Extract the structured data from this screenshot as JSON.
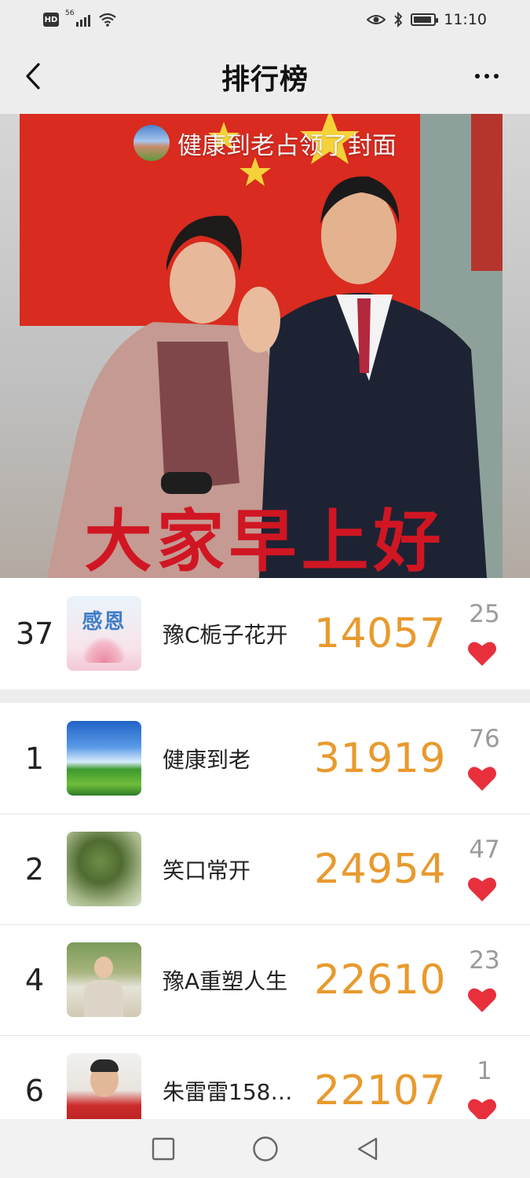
{
  "status_bar": {
    "hd": "HD",
    "network": "56",
    "time": "11:10",
    "battery_level": 0.9
  },
  "nav": {
    "title": "排行榜"
  },
  "cover": {
    "owner_caption": "健康到老占领了封面",
    "greeting": "大家早上好",
    "flag_color": "#d92b1f"
  },
  "my_rank": {
    "rank": "37",
    "avatar_text": "感恩",
    "name": "豫C栀子花开",
    "steps": "14057",
    "likes": "25"
  },
  "rankings": [
    {
      "rank": "1",
      "name": "健康到老",
      "steps": "31919",
      "likes": "76",
      "avatar": "sky"
    },
    {
      "rank": "2",
      "name": "笑口常开",
      "steps": "24954",
      "likes": "47",
      "avatar": "tree"
    },
    {
      "rank": "4",
      "name": "豫A重塑人生",
      "steps": "22610",
      "likes": "23",
      "avatar": "person"
    },
    {
      "rank": "6",
      "name": "朱雷雷1583...",
      "steps": "22107",
      "likes": "1",
      "avatar": "man"
    }
  ],
  "colors": {
    "steps": "#e89a2e",
    "heart": "#e8303d",
    "likes": "#9b9b9b"
  },
  "icons": {
    "back": "chevron-left-icon",
    "more": "more-dots-icon",
    "heart": "heart-icon",
    "recent": "square-icon",
    "home": "circle-icon",
    "back_nav": "triangle-back-icon"
  }
}
